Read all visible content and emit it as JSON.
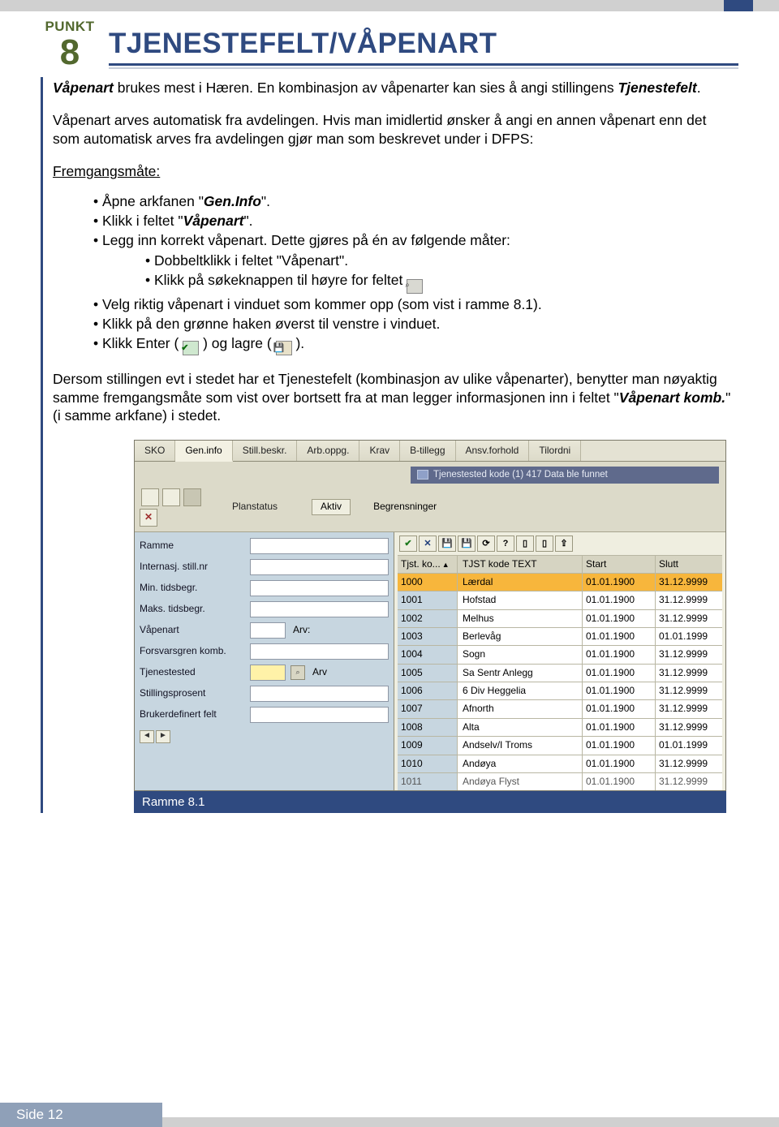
{
  "header": {
    "punkt_label": "PUNKT",
    "punkt_number": "8",
    "title": "TJENESTEFELT/VÅPENART"
  },
  "intro": {
    "lead_bold": "Våpenart",
    "lead_rest": " brukes mest i Hæren. En kombinasjon av våpenarter kan sies å angi stillingens ",
    "lead_bold2": "Tjenestefelt",
    "lead_tail": "."
  },
  "para2": "Våpenart arves automatisk fra avdelingen. Hvis man imidlertid ønsker å angi en annen våpenart enn det som automatisk arves fra avdelingen gjør man som beskrevet under i DFPS:",
  "fremg_label": "Fremgangsmåte:",
  "steps": {
    "s1a": "Åpne arkfanen \"",
    "s1b": "Gen.Info",
    "s1c": "\".",
    "s2a": "Klikk i feltet \"",
    "s2b": "Våpenart",
    "s2c": "\".",
    "s3": "Legg inn korrekt våpenart. Dette gjøres på  én av følgende måter:",
    "s3_1": "Dobbeltklikk i feltet \"Våpenart\".",
    "s3_2": "Klikk på søkeknappen til høyre for feltet",
    "s4": "Velg riktig våpenart i vinduet som kommer opp (som vist i ramme 8.1).",
    "s5": "Klikk på den grønne haken øverst til venstre i vinduet.",
    "s6a": "Klikk Enter (",
    "s6b": ") og lagre (",
    "s6c": ")."
  },
  "para3a": "Dersom stillingen evt i stedet har et Tjenestefelt (kombinasjon av ulike våpenarter), benytter man nøyaktig samme fremgangsmåte som vist over bortsett fra at man legger informasjonen inn i feltet \"",
  "para3b": "Våpenart komb.",
  "para3c": "\" (i samme arkfane) i  stedet.",
  "screenshot": {
    "tabs": [
      "SKO",
      "Gen.info",
      "Still.beskr.",
      "Arb.oppg.",
      "Krav",
      "B-tillegg",
      "Ansv.forhold",
      "Tilordni"
    ],
    "active_tab_index": 1,
    "status_msg": "Tjenestested kode (1)  417 Data ble funnet",
    "planstatus_label": "Planstatus",
    "planstatus_value": "Aktiv",
    "begrensninger_label": "Begrensninger",
    "arv_label": "Arv:",
    "arv_field": "Arv",
    "left_labels": [
      "Ramme",
      "Internasj. still.nr",
      "Min. tidsbegr.",
      "Maks. tidsbegr.",
      "Våpenart",
      "Forsvarsgren komb.",
      "Tjenestested",
      "Stillingsprosent",
      "Brukerdefinert felt"
    ],
    "grid_headers": [
      "Tjst. ko...",
      "TJST kode TEXT",
      "Start",
      "Slutt"
    ],
    "rows": [
      {
        "code": "1000",
        "text": "Lærdal",
        "start": "01.01.1900",
        "end": "31.12.9999",
        "sel": true
      },
      {
        "code": "1001",
        "text": "Hofstad",
        "start": "01.01.1900",
        "end": "31.12.9999"
      },
      {
        "code": "1002",
        "text": "Melhus",
        "start": "01.01.1900",
        "end": "31.12.9999"
      },
      {
        "code": "1003",
        "text": "Berlevåg",
        "start": "01.01.1900",
        "end": "01.01.1999"
      },
      {
        "code": "1004",
        "text": "Sogn",
        "start": "01.01.1900",
        "end": "31.12.9999"
      },
      {
        "code": "1005",
        "text": "Sa Sentr Anlegg",
        "start": "01.01.1900",
        "end": "31.12.9999"
      },
      {
        "code": "1006",
        "text": "6 Div Heggelia",
        "start": "01.01.1900",
        "end": "31.12.9999"
      },
      {
        "code": "1007",
        "text": "Afnorth",
        "start": "01.01.1900",
        "end": "31.12.9999"
      },
      {
        "code": "1008",
        "text": "Alta",
        "start": "01.01.1900",
        "end": "31.12.9999"
      },
      {
        "code": "1009",
        "text": "Andselv/I Troms",
        "start": "01.01.1900",
        "end": "01.01.1999"
      },
      {
        "code": "1010",
        "text": "Andøya",
        "start": "01.01.1900",
        "end": "31.12.9999"
      },
      {
        "code": "1011",
        "text": "Andøya Flyst",
        "start": "01.01.1900",
        "end": "31.12.9999",
        "last": true
      }
    ],
    "caption": "Ramme 8.1"
  },
  "footer": {
    "page": "Side 12"
  }
}
